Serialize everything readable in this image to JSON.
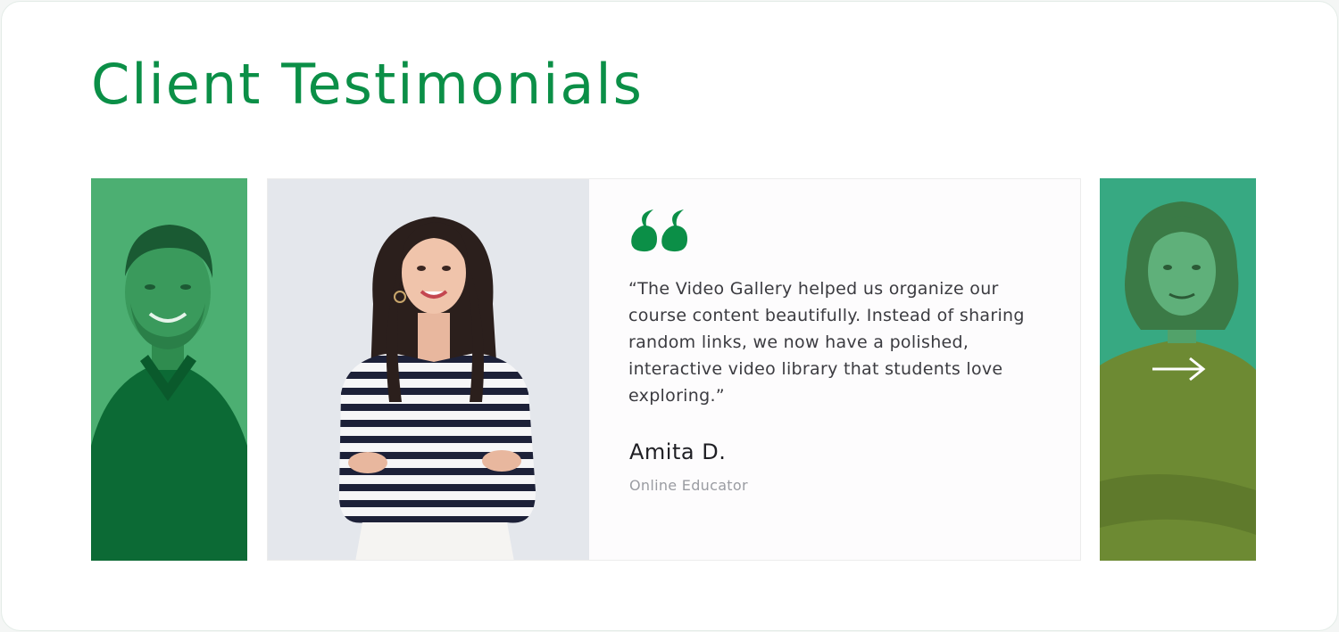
{
  "section": {
    "title": "Client Testimonials"
  },
  "testimonial": {
    "quote": "“The Video Gallery helped us organize our course content beautifully. Instead of sharing random links, we now have a polished, interactive video library that students love exploring.”",
    "name": "Amita D.",
    "role": "Online Educator"
  },
  "icons": {
    "quote": "quote-icon",
    "next": "arrow-right-icon"
  },
  "colors": {
    "accent": "#0b8f47",
    "overlay": "#1f9a55"
  }
}
